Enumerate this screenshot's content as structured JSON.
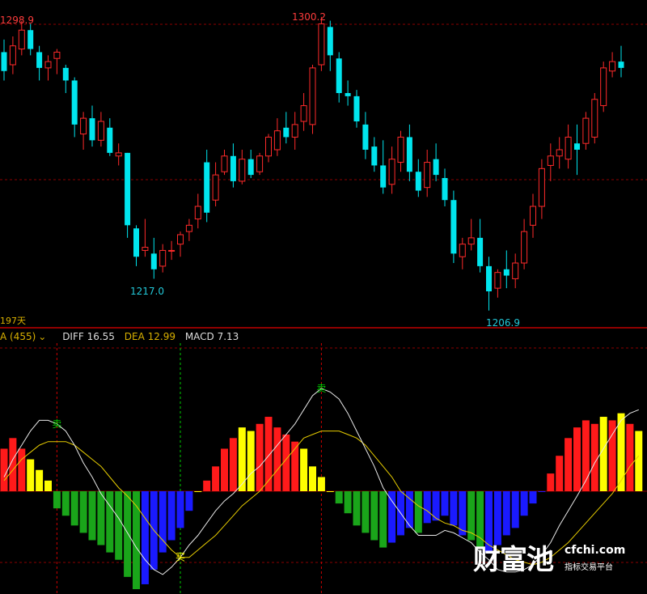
{
  "colors": {
    "bull": "#ff2a2a",
    "bear": "#00e5ee",
    "diff": "#e8e8e8",
    "dea": "#e6cc00",
    "hist_red": "#ff1a1a",
    "hist_yellow": "#ffff00",
    "hist_green": "#1aa51a",
    "hist_blue": "#1a1aff",
    "grid": "#8b0000",
    "vline_green": "#00cc00",
    "vline_red": "#cc0000",
    "text_red": "#ff3c3c",
    "text_cyan": "#22c8d8",
    "text_gold": "#d8b000",
    "text_white": "#dddddd"
  },
  "price_panel": {
    "period_label": "197天",
    "high_label": "1298.9",
    "peak_label": "1300.2",
    "low1_label": "1217.0",
    "low2_label": "1206.9"
  },
  "indicator": {
    "name_label": "A (455)",
    "dropdown_glyph": "⌄",
    "diff_label": "DIFF 16.55",
    "dea_label": "DEA 12.99",
    "macd_label": "MACD 7.13",
    "buy_glyph": "买",
    "sell_glyph": "卖"
  },
  "watermark": {
    "brand_cn": "财富池",
    "brand_en": "cfchi.com",
    "tagline": "指标交易平台"
  },
  "chart_data": {
    "type": "candlestick",
    "price_range": [
      1204,
      1303
    ],
    "candles": [
      [
        1289,
        1293,
        1280,
        1283
      ],
      [
        1285,
        1294,
        1282,
        1291
      ],
      [
        1290,
        1298.9,
        1288,
        1296
      ],
      [
        1296,
        1298,
        1288,
        1290
      ],
      [
        1289,
        1291,
        1280,
        1284
      ],
      [
        1284,
        1288,
        1280,
        1286
      ],
      [
        1287,
        1290,
        1282,
        1289
      ],
      [
        1284,
        1285,
        1276,
        1280
      ],
      [
        1280,
        1281,
        1262,
        1266
      ],
      [
        1263,
        1270,
        1258,
        1268
      ],
      [
        1268,
        1272,
        1259,
        1261
      ],
      [
        1261,
        1270,
        1259,
        1267
      ],
      [
        1265,
        1268,
        1256,
        1257
      ],
      [
        1256,
        1260,
        1253,
        1257
      ],
      [
        1257,
        1257,
        1230,
        1234
      ],
      [
        1233,
        1234,
        1221,
        1224
      ],
      [
        1226,
        1236,
        1224,
        1227
      ],
      [
        1225,
        1230,
        1217,
        1220
      ],
      [
        1221,
        1228,
        1219,
        1226
      ],
      [
        1226,
        1229,
        1223,
        1226
      ],
      [
        1228,
        1232,
        1224,
        1231
      ],
      [
        1232,
        1236,
        1229,
        1234
      ],
      [
        1236,
        1244,
        1233,
        1240
      ],
      [
        1254,
        1258,
        1235,
        1238
      ],
      [
        1242,
        1254,
        1240,
        1250
      ],
      [
        1251,
        1258,
        1250,
        1256
      ],
      [
        1256,
        1260,
        1246,
        1248
      ],
      [
        1248,
        1258,
        1247,
        1255
      ],
      [
        1255,
        1258,
        1249,
        1250
      ],
      [
        1251,
        1257,
        1250,
        1256
      ],
      [
        1256,
        1263,
        1254,
        1262
      ],
      [
        1258,
        1268,
        1256,
        1264
      ],
      [
        1265,
        1270,
        1260,
        1262
      ],
      [
        1262,
        1270,
        1258,
        1266
      ],
      [
        1267,
        1276,
        1264,
        1272
      ],
      [
        1266,
        1285,
        1263,
        1284
      ],
      [
        1285,
        1300.2,
        1283,
        1298
      ],
      [
        1297,
        1299,
        1283,
        1288
      ],
      [
        1287,
        1289,
        1273,
        1276
      ],
      [
        1276,
        1280,
        1272,
        1275
      ],
      [
        1275,
        1277,
        1265,
        1267
      ],
      [
        1266,
        1270,
        1255,
        1258
      ],
      [
        1259,
        1262,
        1251,
        1253
      ],
      [
        1253,
        1261,
        1244,
        1246
      ],
      [
        1247,
        1259,
        1244,
        1255
      ],
      [
        1254,
        1264,
        1251,
        1262
      ],
      [
        1262,
        1266,
        1248,
        1251
      ],
      [
        1251,
        1255,
        1243,
        1245
      ],
      [
        1246,
        1258,
        1243,
        1254
      ],
      [
        1255,
        1260,
        1248,
        1250
      ],
      [
        1249,
        1252,
        1240,
        1242
      ],
      [
        1242,
        1245,
        1222,
        1225
      ],
      [
        1224,
        1230,
        1220,
        1228
      ],
      [
        1228,
        1236,
        1226,
        1230
      ],
      [
        1230,
        1236,
        1219,
        1221
      ],
      [
        1221,
        1224,
        1206.9,
        1213
      ],
      [
        1214,
        1220,
        1211,
        1219
      ],
      [
        1220,
        1226,
        1214,
        1218
      ],
      [
        1217,
        1225,
        1214,
        1222
      ],
      [
        1222,
        1236,
        1220,
        1232
      ],
      [
        1234,
        1244,
        1230,
        1240
      ],
      [
        1240,
        1255,
        1236,
        1252
      ],
      [
        1253,
        1260,
        1248,
        1256
      ],
      [
        1256,
        1262,
        1252,
        1258
      ],
      [
        1255,
        1266,
        1252,
        1262
      ],
      [
        1260,
        1266,
        1250,
        1258
      ],
      [
        1260,
        1270,
        1258,
        1268
      ],
      [
        1262,
        1276,
        1260,
        1274
      ],
      [
        1272,
        1286,
        1270,
        1284
      ],
      [
        1283,
        1289,
        1281,
        1286
      ],
      [
        1286,
        1291,
        1281,
        1284
      ]
    ],
    "macd": {
      "range": [
        -40,
        29
      ],
      "histogram": [
        12,
        15,
        12,
        9,
        6,
        3,
        -7,
        -10,
        -14,
        -17,
        -20,
        -22,
        -25,
        -28,
        -35,
        -40,
        -38,
        -32,
        -25,
        -20,
        -15,
        -8,
        0,
        3,
        7,
        12,
        15,
        18,
        17,
        19,
        21,
        18,
        16,
        14,
        12,
        7,
        4,
        0,
        -5,
        -9,
        -14,
        -17,
        -20,
        -23,
        -21,
        -18,
        -15,
        -17,
        -13,
        -12,
        -10,
        -14,
        -18,
        -20,
        -23,
        -25,
        -22,
        -18,
        -15,
        -10,
        -5,
        0,
        5,
        10,
        15,
        18,
        20,
        19,
        21,
        20,
        22,
        19,
        17
      ],
      "hist_colors": [
        "r",
        "r",
        "r",
        "y",
        "y",
        "y",
        "g",
        "g",
        "g",
        "g",
        "g",
        "g",
        "g",
        "g",
        "g",
        "g",
        "b",
        "b",
        "b",
        "b",
        "b",
        "b",
        "y",
        "r",
        "r",
        "r",
        "r",
        "y",
        "y",
        "r",
        "r",
        "r",
        "r",
        "r",
        "y",
        "y",
        "y",
        "y",
        "g",
        "g",
        "g",
        "g",
        "g",
        "g",
        "b",
        "b",
        "b",
        "g",
        "b",
        "b",
        "b",
        "b",
        "b",
        "g",
        "g",
        "b",
        "b",
        "b",
        "b",
        "b",
        "b",
        "b",
        "r",
        "r",
        "r",
        "r",
        "r",
        "r",
        "y",
        "r",
        "y",
        "r",
        "y"
      ],
      "diff": [
        4,
        9,
        13,
        17,
        20,
        20,
        19,
        17,
        13,
        8,
        4,
        -1,
        -6,
        -11,
        -17,
        -23,
        -28,
        -32,
        -34,
        -31,
        -27,
        -22,
        -18,
        -13,
        -8,
        -4,
        -1,
        2,
        5,
        7,
        10,
        13,
        16,
        19,
        23,
        27,
        29,
        28,
        26,
        22,
        17,
        12,
        7,
        1,
        -4,
        -9,
        -14,
        -18,
        -18,
        -18,
        -16,
        -17,
        -19,
        -21,
        -25,
        -28,
        -32,
        -33,
        -33,
        -32,
        -30,
        -26,
        -21,
        -14,
        -8,
        -2,
        3,
        8,
        12,
        16,
        20,
        22,
        23
      ],
      "dea": [
        3,
        6,
        9,
        11,
        13,
        14,
        14,
        14,
        13,
        11,
        9,
        7,
        4,
        1,
        -2,
        -6,
        -11,
        -16,
        -20,
        -24,
        -27,
        -27,
        -24,
        -21,
        -18,
        -14,
        -10,
        -6,
        -3,
        0,
        3,
        6,
        9,
        12,
        15,
        16,
        17,
        17,
        17,
        16,
        15,
        13,
        10,
        7,
        4,
        0,
        -3,
        -6,
        -8,
        -11,
        -13,
        -14,
        -16,
        -17,
        -19,
        -22,
        -24,
        -26,
        -28,
        -29,
        -30,
        -29,
        -27,
        -24,
        -21,
        -17,
        -13,
        -9,
        -5,
        -1,
        3,
        7,
        10
      ],
      "signals": [
        {
          "type": "sell",
          "index": 6
        },
        {
          "type": "buy",
          "index": 20
        },
        {
          "type": "sell",
          "index": 36
        }
      ]
    }
  }
}
